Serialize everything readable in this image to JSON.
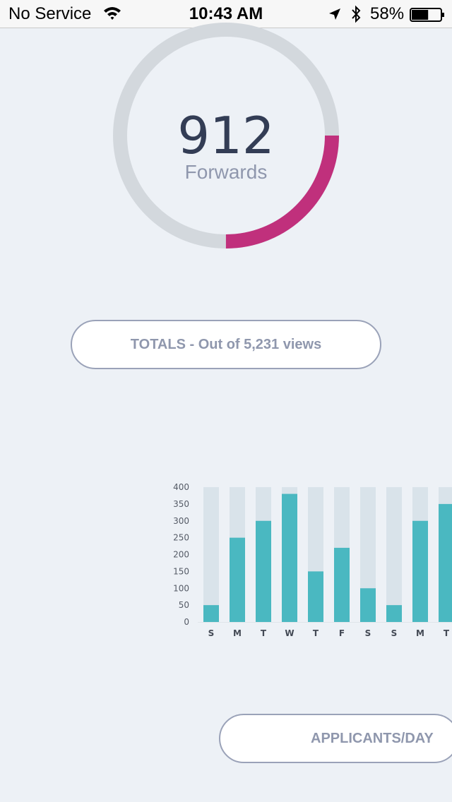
{
  "status_bar": {
    "carrier": "No Service",
    "time": "10:43 AM",
    "battery_percent": "58%",
    "battery_level": 0.58
  },
  "summary": {
    "value": "912",
    "label": "Forwards",
    "progress": 0.25,
    "track_color": "#d3d8dd",
    "progress_color": "#c0307c"
  },
  "totals_button": {
    "label": "TOTALS - Out of 5,231 views"
  },
  "applicants_button": {
    "label": "APPLICANTS/DAY"
  },
  "chart_data": {
    "type": "bar",
    "categories": [
      "S",
      "M",
      "T",
      "W",
      "T",
      "F",
      "S",
      "S",
      "M",
      "T"
    ],
    "values": [
      50,
      250,
      300,
      380,
      150,
      220,
      100,
      50,
      300,
      350
    ],
    "max_values": [
      400,
      400,
      400,
      400,
      400,
      400,
      400,
      400,
      400,
      400
    ],
    "ylim": [
      0,
      400
    ],
    "yticks": [
      0,
      50,
      100,
      150,
      200,
      250,
      300,
      350,
      400
    ],
    "bar_color": "#4ab8c1",
    "background_bar_color": "#d9e3ea",
    "title": "",
    "xlabel": "",
    "ylabel": ""
  }
}
